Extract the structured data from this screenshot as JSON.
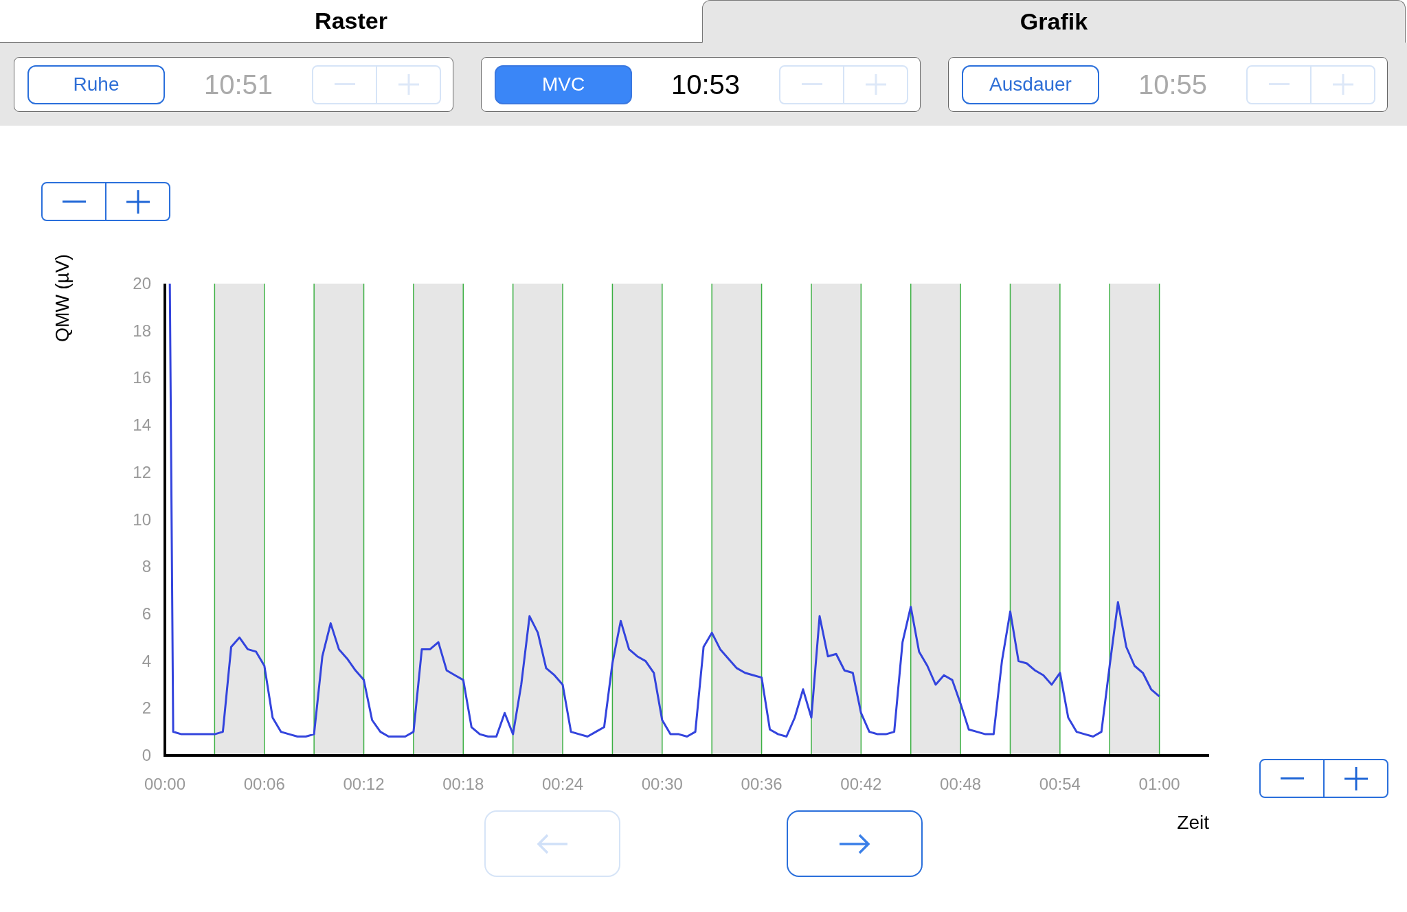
{
  "tabs": [
    {
      "label": "Raster",
      "selected": false
    },
    {
      "label": "Grafik",
      "selected": true
    }
  ],
  "phases": [
    {
      "label": "Ruhe",
      "selected": false,
      "time": "10:51",
      "stepper": {
        "disabled": true
      }
    },
    {
      "label": "MVC",
      "selected": true,
      "time": "10:53",
      "stepper": {
        "disabled": true
      }
    },
    {
      "label": "Ausdauer",
      "selected": false,
      "time": "10:55",
      "stepper": {
        "disabled": true
      }
    }
  ],
  "y_zoom": {
    "disabled": false
  },
  "x_zoom": {
    "disabled": false
  },
  "navigation": {
    "back": {
      "disabled": true
    },
    "forward": {
      "disabled": false
    }
  },
  "chart_data": {
    "type": "line",
    "xlabel": "Zeit",
    "ylabel": "QMW (µV)",
    "xlim": [
      0,
      63
    ],
    "ylim": [
      0,
      20
    ],
    "xticks": [
      {
        "value": 0,
        "label": "00:00"
      },
      {
        "value": 6,
        "label": "00:06"
      },
      {
        "value": 12,
        "label": "00:12"
      },
      {
        "value": 18,
        "label": "00:18"
      },
      {
        "value": 24,
        "label": "00:24"
      },
      {
        "value": 30,
        "label": "00:30"
      },
      {
        "value": 36,
        "label": "00:36"
      },
      {
        "value": 42,
        "label": "00:42"
      },
      {
        "value": 48,
        "label": "00:48"
      },
      {
        "value": 54,
        "label": "00:54"
      },
      {
        "value": 60,
        "label": "01:00"
      }
    ],
    "yticks": [
      0,
      2,
      4,
      6,
      8,
      10,
      12,
      14,
      16,
      18,
      20
    ],
    "x": [
      0.3,
      0.5,
      1,
      1.5,
      2,
      2.5,
      3,
      3.5,
      4,
      4.5,
      5,
      5.5,
      6,
      6.5,
      7,
      7.5,
      8,
      8.5,
      9,
      9.5,
      10,
      10.5,
      11,
      11.5,
      12,
      12.5,
      13,
      13.5,
      14,
      14.5,
      15,
      15.5,
      16,
      16.5,
      17,
      17.5,
      18,
      18.5,
      19,
      19.5,
      20,
      20.5,
      21,
      21.5,
      22,
      22.5,
      23,
      23.5,
      24,
      24.5,
      25,
      25.5,
      26,
      26.5,
      27,
      27.5,
      28,
      28.5,
      29,
      29.5,
      30,
      30.5,
      31,
      31.5,
      32,
      32.5,
      33,
      33.5,
      34,
      34.5,
      35,
      35.5,
      36,
      36.5,
      37,
      37.5,
      38,
      38.5,
      39,
      39.5,
      40,
      40.5,
      41,
      41.5,
      42,
      42.5,
      43,
      43.5,
      44,
      44.5,
      45,
      45.5,
      46,
      46.5,
      47,
      47.5,
      48,
      48.5,
      49,
      49.5,
      50,
      50.5,
      51,
      51.5,
      52,
      52.5,
      53,
      53.5,
      54,
      54.5,
      55,
      55.5,
      56,
      56.5,
      57,
      57.5,
      58,
      58.5,
      59,
      59.5,
      60
    ],
    "series": [
      {
        "color": "#3344dd",
        "values": [
          20,
          1.0,
          0.9,
          0.9,
          0.9,
          0.9,
          0.9,
          1.0,
          4.6,
          5.0,
          4.5,
          4.4,
          3.8,
          1.6,
          1.0,
          0.9,
          0.8,
          0.8,
          0.9,
          4.2,
          5.6,
          4.5,
          4.1,
          3.6,
          3.2,
          1.5,
          1.0,
          0.8,
          0.8,
          0.8,
          1.0,
          4.5,
          4.5,
          4.8,
          3.6,
          3.4,
          3.2,
          1.2,
          0.9,
          0.8,
          0.8,
          1.8,
          0.9,
          3.0,
          5.9,
          5.2,
          3.7,
          3.4,
          3.0,
          1.0,
          0.9,
          0.8,
          1.0,
          1.2,
          3.9,
          5.7,
          4.5,
          4.2,
          4.0,
          3.5,
          1.5,
          0.9,
          0.9,
          0.8,
          1.0,
          4.6,
          5.2,
          4.5,
          4.1,
          3.7,
          3.5,
          3.4,
          3.3,
          1.1,
          0.9,
          0.8,
          1.6,
          2.8,
          1.6,
          5.9,
          4.2,
          4.3,
          3.6,
          3.5,
          1.8,
          1.0,
          0.9,
          0.9,
          1.0,
          4.8,
          6.3,
          4.4,
          3.8,
          3.0,
          3.4,
          3.2,
          2.2,
          1.1,
          1.0,
          0.9,
          0.9,
          4.0,
          6.1,
          4.0,
          3.9,
          3.6,
          3.4,
          3.0,
          3.5,
          1.6,
          1.0,
          0.9,
          0.8,
          1.0,
          3.8,
          6.5,
          4.6,
          3.8,
          3.5,
          2.8,
          2.5
        ]
      }
    ],
    "grid": true,
    "bands": [
      {
        "axis": "x",
        "from": 3,
        "to": 6
      },
      {
        "axis": "x",
        "from": 9,
        "to": 12
      },
      {
        "axis": "x",
        "from": 15,
        "to": 18
      },
      {
        "axis": "x",
        "from": 21,
        "to": 24
      },
      {
        "axis": "x",
        "from": 27,
        "to": 30
      },
      {
        "axis": "x",
        "from": 33,
        "to": 36
      },
      {
        "axis": "x",
        "from": 39,
        "to": 42
      },
      {
        "axis": "x",
        "from": 45,
        "to": 48
      },
      {
        "axis": "x",
        "from": 51,
        "to": 54
      },
      {
        "axis": "x",
        "from": 57,
        "to": 60
      }
    ]
  }
}
